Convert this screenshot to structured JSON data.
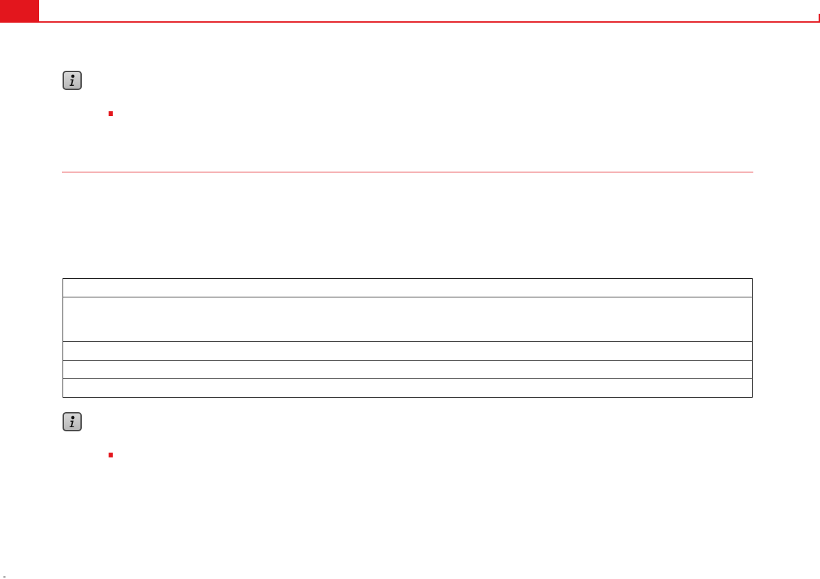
{
  "colors": {
    "accent": "#e3161d",
    "table_border": "#1a1a1a",
    "icon_border": "#4a4a4a"
  },
  "icons": {
    "note": "info-icon",
    "bullet": "bullet-icon"
  },
  "notes": [
    {
      "icon": "info-icon",
      "bullet_items": 1
    },
    {
      "icon": "info-icon",
      "bullet_items": 1
    }
  ],
  "table": {
    "rows": 5,
    "columns": 1
  }
}
